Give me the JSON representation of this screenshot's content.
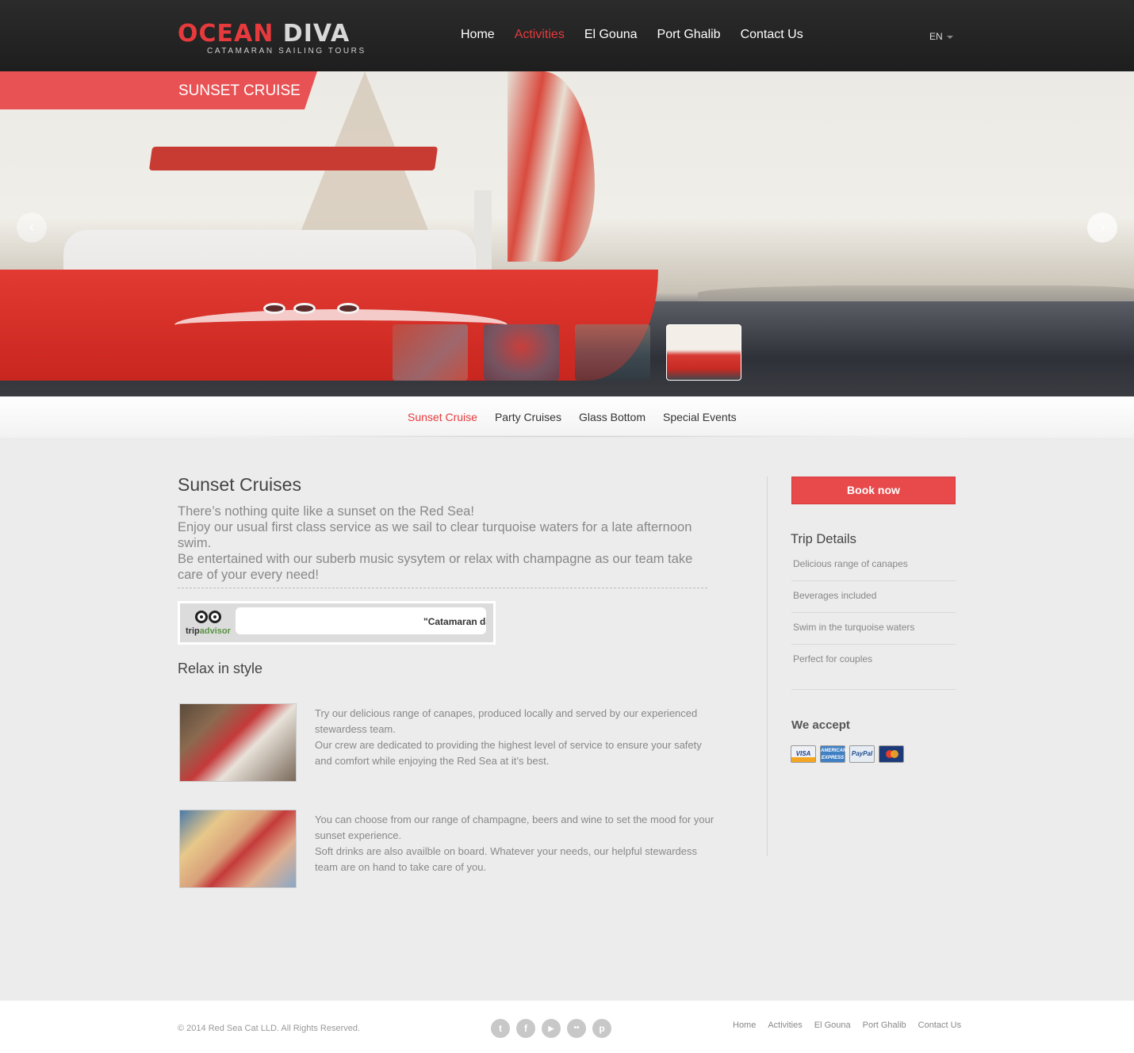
{
  "brand": {
    "logo_part1": "OCEAN",
    "logo_part2": "DIVA",
    "tagline": "CATAMARAN SAILING TOURS"
  },
  "nav": {
    "items": [
      {
        "label": "Home",
        "active": false
      },
      {
        "label": "Activities",
        "active": true
      },
      {
        "label": "El Gouna",
        "active": false
      },
      {
        "label": "Port Ghalib",
        "active": false
      },
      {
        "label": "Contact Us",
        "active": false
      }
    ],
    "language": "EN"
  },
  "hero": {
    "badge": "SUNSET CRUISE",
    "prev_icon": "chevron-left-icon",
    "next_icon": "chevron-right-icon",
    "active_thumb_index": 3
  },
  "subnav": {
    "items": [
      {
        "label": "Sunset Cruise",
        "active": true
      },
      {
        "label": "Party Cruises",
        "active": false
      },
      {
        "label": "Glass Bottom",
        "active": false
      },
      {
        "label": "Special Events",
        "active": false
      }
    ]
  },
  "main": {
    "title": "Sunset Cruises",
    "intro": "There’s nothing quite like a sunset on the Red Sea!\nEnjoy our usual first class service as we sail to clear turquoise waters for a late afternoon swim.\nBe entertained with our suberb music sysytem or relax with champagne as our team take care of your every need!",
    "tripadvisor": {
      "logo_part1": "trip",
      "logo_part2": "advisor",
      "quote": "\"Catamaran da"
    },
    "subtitle": "Relax in style",
    "features": [
      {
        "text": "Try our delicious range of canapes, produced locally and served by our experienced stewardess team.\nOur crew are dedicated to providing the highest level of service  to ensure your safety and comfort while enjoying the Red Sea at it’s best."
      },
      {
        "text": "You can choose from our range of champagne, beers and wine to set the mood for your sunset experience.\nSoft drinks are also availble on board. Whatever your needs, our helpful stewardess team are on hand to take care of you."
      }
    ]
  },
  "sidebar": {
    "book_label": "Book now",
    "trip_title": "Trip Details",
    "trip_items": [
      "Delicious range of canapes",
      "Beverages included",
      "Swim in the turquoise waters",
      "Perfect for couples"
    ],
    "accept_title": "We accept",
    "cards": [
      {
        "label": "VISA",
        "icon": "visa-card-icon"
      },
      {
        "label": "AMERICAN EXPRESS",
        "icon": "amex-card-icon"
      },
      {
        "label": "PayPal",
        "icon": "paypal-card-icon"
      },
      {
        "label": "",
        "icon": "mastercard-icon"
      }
    ]
  },
  "footer": {
    "copyright": "© 2014 Red Sea Cat LLD. All Rights Reserved.",
    "social": [
      {
        "name": "twitter-icon",
        "glyph": "t"
      },
      {
        "name": "facebook-icon",
        "glyph": "f"
      },
      {
        "name": "youtube-icon",
        "glyph": "▶"
      },
      {
        "name": "flickr-icon",
        "glyph": "••"
      },
      {
        "name": "pinterest-icon",
        "glyph": "p"
      }
    ],
    "links": [
      "Home",
      "Activities",
      "El Gouna",
      "Port Ghalib",
      "Contact Us"
    ]
  },
  "colors": {
    "accent": "#e63a3d",
    "header_bg": "#232323",
    "page_bg": "#ececec"
  }
}
